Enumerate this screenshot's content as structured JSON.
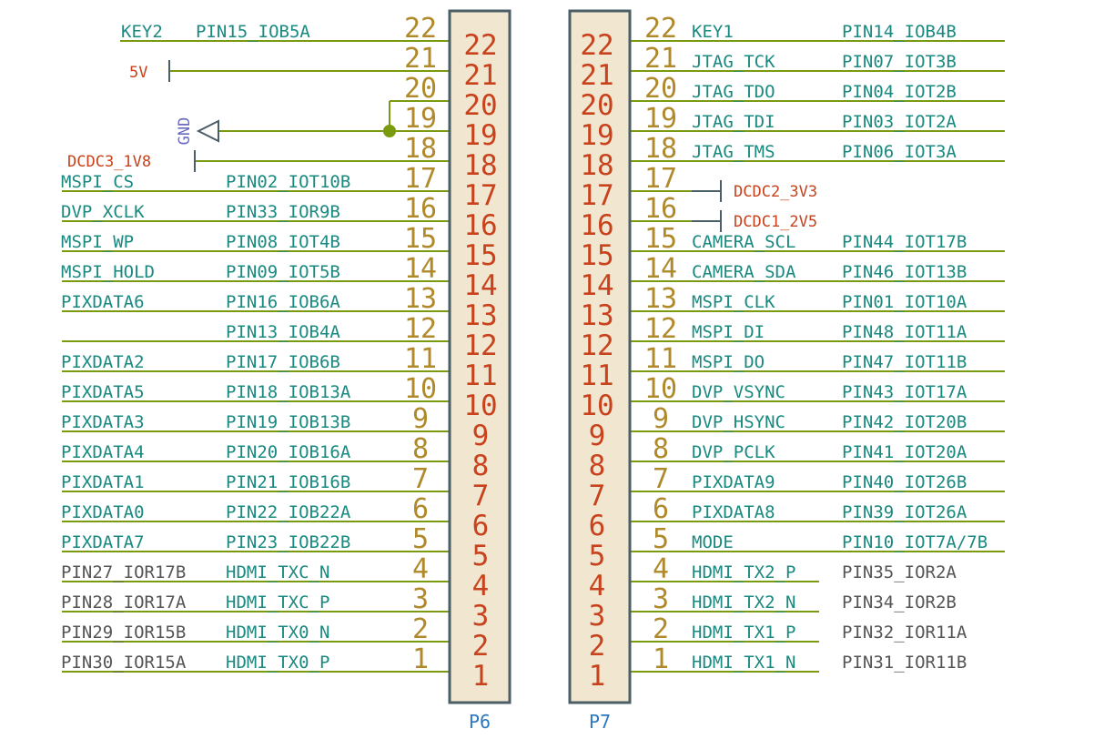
{
  "colors": {
    "wire": "#7a9a10",
    "pin_number": "#b08a2a",
    "body_number": "#c8431d",
    "net_label": "#1a8a80",
    "gray_label": "#555555",
    "power_label": "#c8431d",
    "gnd_label": "#6a6ac0",
    "ref_label": "#2b78c0",
    "body_fill": "#f1e6d0",
    "body_stroke": "#4b5f66",
    "power_symbol": "#4b5f66",
    "junction": "#7a9a10"
  },
  "connectors": [
    {
      "ref": "P6",
      "pins": [
        {
          "num": "22",
          "labels": [
            "KEY2",
            "PIN15_IOB5A"
          ]
        },
        {
          "num": "21",
          "power": "5V"
        },
        {
          "num": "20"
        },
        {
          "num": "19",
          "ground": "GND"
        },
        {
          "num": "18",
          "power": "DCDC3_1V8"
        },
        {
          "num": "17",
          "labels": [
            "MSPI_CS",
            "PIN02_IOT10B"
          ]
        },
        {
          "num": "16",
          "labels": [
            "DVP_XCLK",
            "PIN33_IOR9B"
          ]
        },
        {
          "num": "15",
          "labels": [
            "MSPI_WP",
            "PIN08_IOT4B"
          ]
        },
        {
          "num": "14",
          "labels": [
            "MSPI_HOLD",
            "PIN09_IOT5B"
          ]
        },
        {
          "num": "13",
          "labels": [
            "PIXDATA6",
            "PIN16_IOB6A"
          ]
        },
        {
          "num": "12",
          "labels": [
            "",
            "PIN13_IOB4A"
          ]
        },
        {
          "num": "11",
          "labels": [
            "PIXDATA2",
            "PIN17_IOB6B"
          ]
        },
        {
          "num": "10",
          "labels": [
            "PIXDATA5",
            "PIN18_IOB13A"
          ]
        },
        {
          "num": "9",
          "labels": [
            "PIXDATA3",
            "PIN19_IOB13B"
          ]
        },
        {
          "num": "8",
          "labels": [
            "PIXDATA4",
            "PIN20_IOB16A"
          ]
        },
        {
          "num": "7",
          "labels": [
            "PIXDATA1",
            "PIN21_IOB16B"
          ]
        },
        {
          "num": "6",
          "labels": [
            "PIXDATA0",
            "PIN22_IOB22A"
          ]
        },
        {
          "num": "5",
          "labels": [
            "PIXDATA7",
            "PIN23_IOB22B"
          ]
        },
        {
          "num": "4",
          "labels": [
            "PIN27_IOR17B",
            "HDMI_TXC_N"
          ]
        },
        {
          "num": "3",
          "labels": [
            "PIN28_IOR17A",
            "HDMI_TXC_P"
          ]
        },
        {
          "num": "2",
          "labels": [
            "PIN29_IOR15B",
            "HDMI_TX0_N"
          ]
        },
        {
          "num": "1",
          "labels": [
            "PIN30_IOR15A",
            "HDMI_TX0_P"
          ]
        }
      ]
    },
    {
      "ref": "P7",
      "pins": [
        {
          "num": "22",
          "labels": [
            "KEY1",
            "PIN14_IOB4B"
          ]
        },
        {
          "num": "21",
          "labels": [
            "JTAG_TCK",
            "PIN07_IOT3B"
          ]
        },
        {
          "num": "20",
          "labels": [
            "JTAG_TDO",
            "PIN04_IOT2B"
          ]
        },
        {
          "num": "19",
          "labels": [
            "JTAG_TDI",
            "PIN03_IOT2A"
          ]
        },
        {
          "num": "18",
          "labels": [
            "JTAG_TMS",
            "PIN06_IOT3A"
          ]
        },
        {
          "num": "17",
          "power": "DCDC2_3V3"
        },
        {
          "num": "16",
          "power": "DCDC1_2V5"
        },
        {
          "num": "15",
          "labels": [
            "CAMERA_SCL",
            "PIN44_IOT17B"
          ]
        },
        {
          "num": "14",
          "labels": [
            "CAMERA_SDA",
            "PIN46_IOT13B"
          ]
        },
        {
          "num": "13",
          "labels": [
            "MSPI_CLK",
            "PIN01_IOT10A"
          ]
        },
        {
          "num": "12",
          "labels": [
            "MSPI_DI",
            "PIN48_IOT11A"
          ]
        },
        {
          "num": "11",
          "labels": [
            "MSPI_DO",
            "PIN47_IOT11B"
          ]
        },
        {
          "num": "10",
          "labels": [
            "DVP_VSYNC",
            "PIN43_IOT17A"
          ]
        },
        {
          "num": "9",
          "labels": [
            "DVP_HSYNC",
            "PIN42_IOT20B"
          ]
        },
        {
          "num": "8",
          "labels": [
            "DVP_PCLK",
            "PIN41_IOT20A"
          ]
        },
        {
          "num": "7",
          "labels": [
            "PIXDATA9",
            "PIN40_IOT26B"
          ]
        },
        {
          "num": "6",
          "labels": [
            "PIXDATA8",
            "PIN39_IOT26A"
          ]
        },
        {
          "num": "5",
          "labels": [
            "MODE",
            "PIN10_IOT7A/7B"
          ]
        },
        {
          "num": "4",
          "labels": [
            "HDMI_TX2_P",
            "PIN35_IOR2A"
          ]
        },
        {
          "num": "3",
          "labels": [
            "HDMI_TX2_N",
            "PIN34_IOR2B"
          ]
        },
        {
          "num": "2",
          "labels": [
            "HDMI_TX1_P",
            "PIN32_IOR11A"
          ]
        },
        {
          "num": "1",
          "labels": [
            "HDMI_TX1_N",
            "PIN31_IOR11B"
          ]
        }
      ]
    }
  ]
}
